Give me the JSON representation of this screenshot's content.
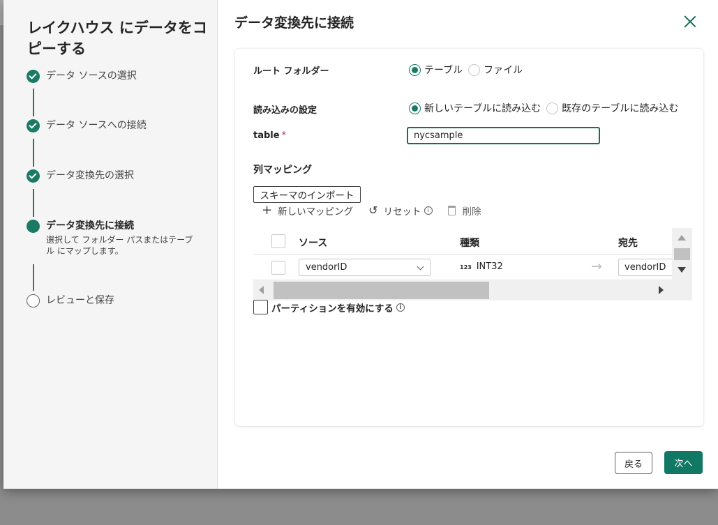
{
  "wizard": {
    "title": "レイクハウス にデータをコピーする",
    "steps": [
      {
        "label": "データ ソースの選択",
        "state": "done"
      },
      {
        "label": "データ ソースへの接続",
        "state": "done"
      },
      {
        "label": "データ変換先の選択",
        "state": "done"
      },
      {
        "label": "データ変換先に接続",
        "state": "current",
        "description": "選択して フォルダー パスまたはテーブル にマップします。"
      },
      {
        "label": "レビューと保存",
        "state": "todo"
      }
    ]
  },
  "main": {
    "title": "データ変換先に接続",
    "root_folder": {
      "label": "ルート フォルダー",
      "options": [
        {
          "label": "テーブル",
          "checked": true
        },
        {
          "label": "ファイル",
          "checked": false
        }
      ]
    },
    "load_settings": {
      "label": "読み込みの設定",
      "options": [
        {
          "label": "新しいテーブルに読み込む",
          "checked": true
        },
        {
          "label": "既存のテーブルに読み込む",
          "checked": false
        }
      ]
    },
    "table": {
      "label": "table",
      "required_mark": "*",
      "value": "nycsample"
    },
    "column_mapping": {
      "title": "列マッピング",
      "import_schema_label": "スキーマのインポート",
      "toolbar": {
        "new_mapping": "新しいマッピング",
        "reset": "リセット",
        "delete": "削除"
      },
      "headers": {
        "source": "ソース",
        "type": "種類",
        "destination": "宛先"
      },
      "rows": [
        {
          "source": "vendorID",
          "type_badge": "123",
          "type": "INT32",
          "destination": "vendorID"
        }
      ]
    },
    "partition_label": "パーティションを有効にする"
  },
  "footer": {
    "back_label": "戻る",
    "next_label": "次へ"
  },
  "colors": {
    "accent": "#117865",
    "step_done": "#1a7a63"
  }
}
